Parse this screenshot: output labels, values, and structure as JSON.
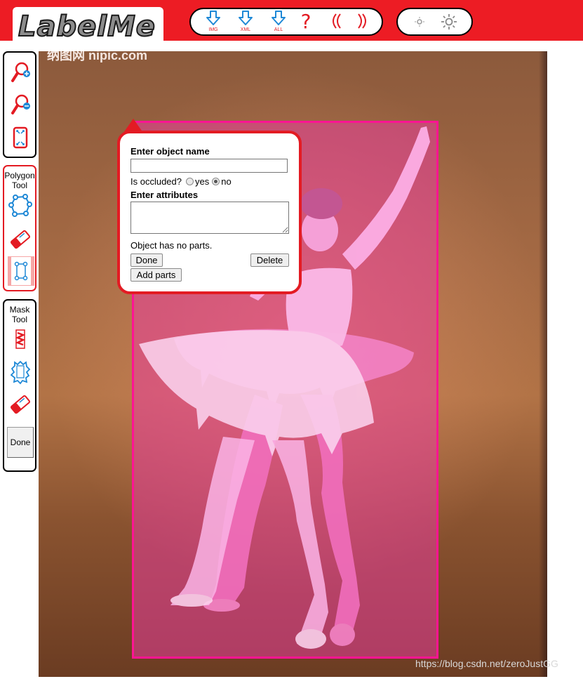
{
  "header": {
    "logo_text": "LabelMe",
    "buttons": [
      {
        "id": "download-img",
        "label": "IMG"
      },
      {
        "id": "download-xml",
        "label": "XML"
      },
      {
        "id": "download-all",
        "label": "ALL"
      }
    ],
    "help_glyph": "?",
    "prev_glyph": "《",
    "next_glyph": "》"
  },
  "tools": {
    "polygon_title": "Polygon Tool",
    "polygon_title_l1": "Polygon",
    "polygon_title_l2": "Tool",
    "mask_title_l1": "Mask",
    "mask_title_l2": "Tool",
    "mask_done_label": "Done"
  },
  "popup": {
    "name_heading": "Enter object name",
    "name_value": "",
    "occluded_label": "Is occluded?",
    "occluded_yes": "yes",
    "occluded_no": "no",
    "occluded_selected": "no",
    "attributes_heading": "Enter attributes",
    "attributes_value": "",
    "parts_status": "Object has no parts.",
    "done_label": "Done",
    "delete_label": "Delete",
    "add_parts_label": "Add parts"
  },
  "canvas": {
    "top_watermark": "纳图网 nipic.com",
    "watermark": "https://blog.csdn.net/zeroJustGG"
  },
  "colors": {
    "brand_red": "#ed1c24",
    "selection_fill": "#eb3ca0",
    "selection_border": "#ff1493",
    "icon_blue": "#1e88d6"
  },
  "icons": [
    "download-icon",
    "help-icon",
    "prev-icon",
    "next-icon",
    "brightness-down-icon",
    "brightness-up-icon",
    "zoom-in-icon",
    "zoom-out-icon",
    "fit-icon",
    "polygon-icon",
    "eraser-icon",
    "bbox-icon",
    "scribble-icon",
    "mask-region-icon"
  ]
}
